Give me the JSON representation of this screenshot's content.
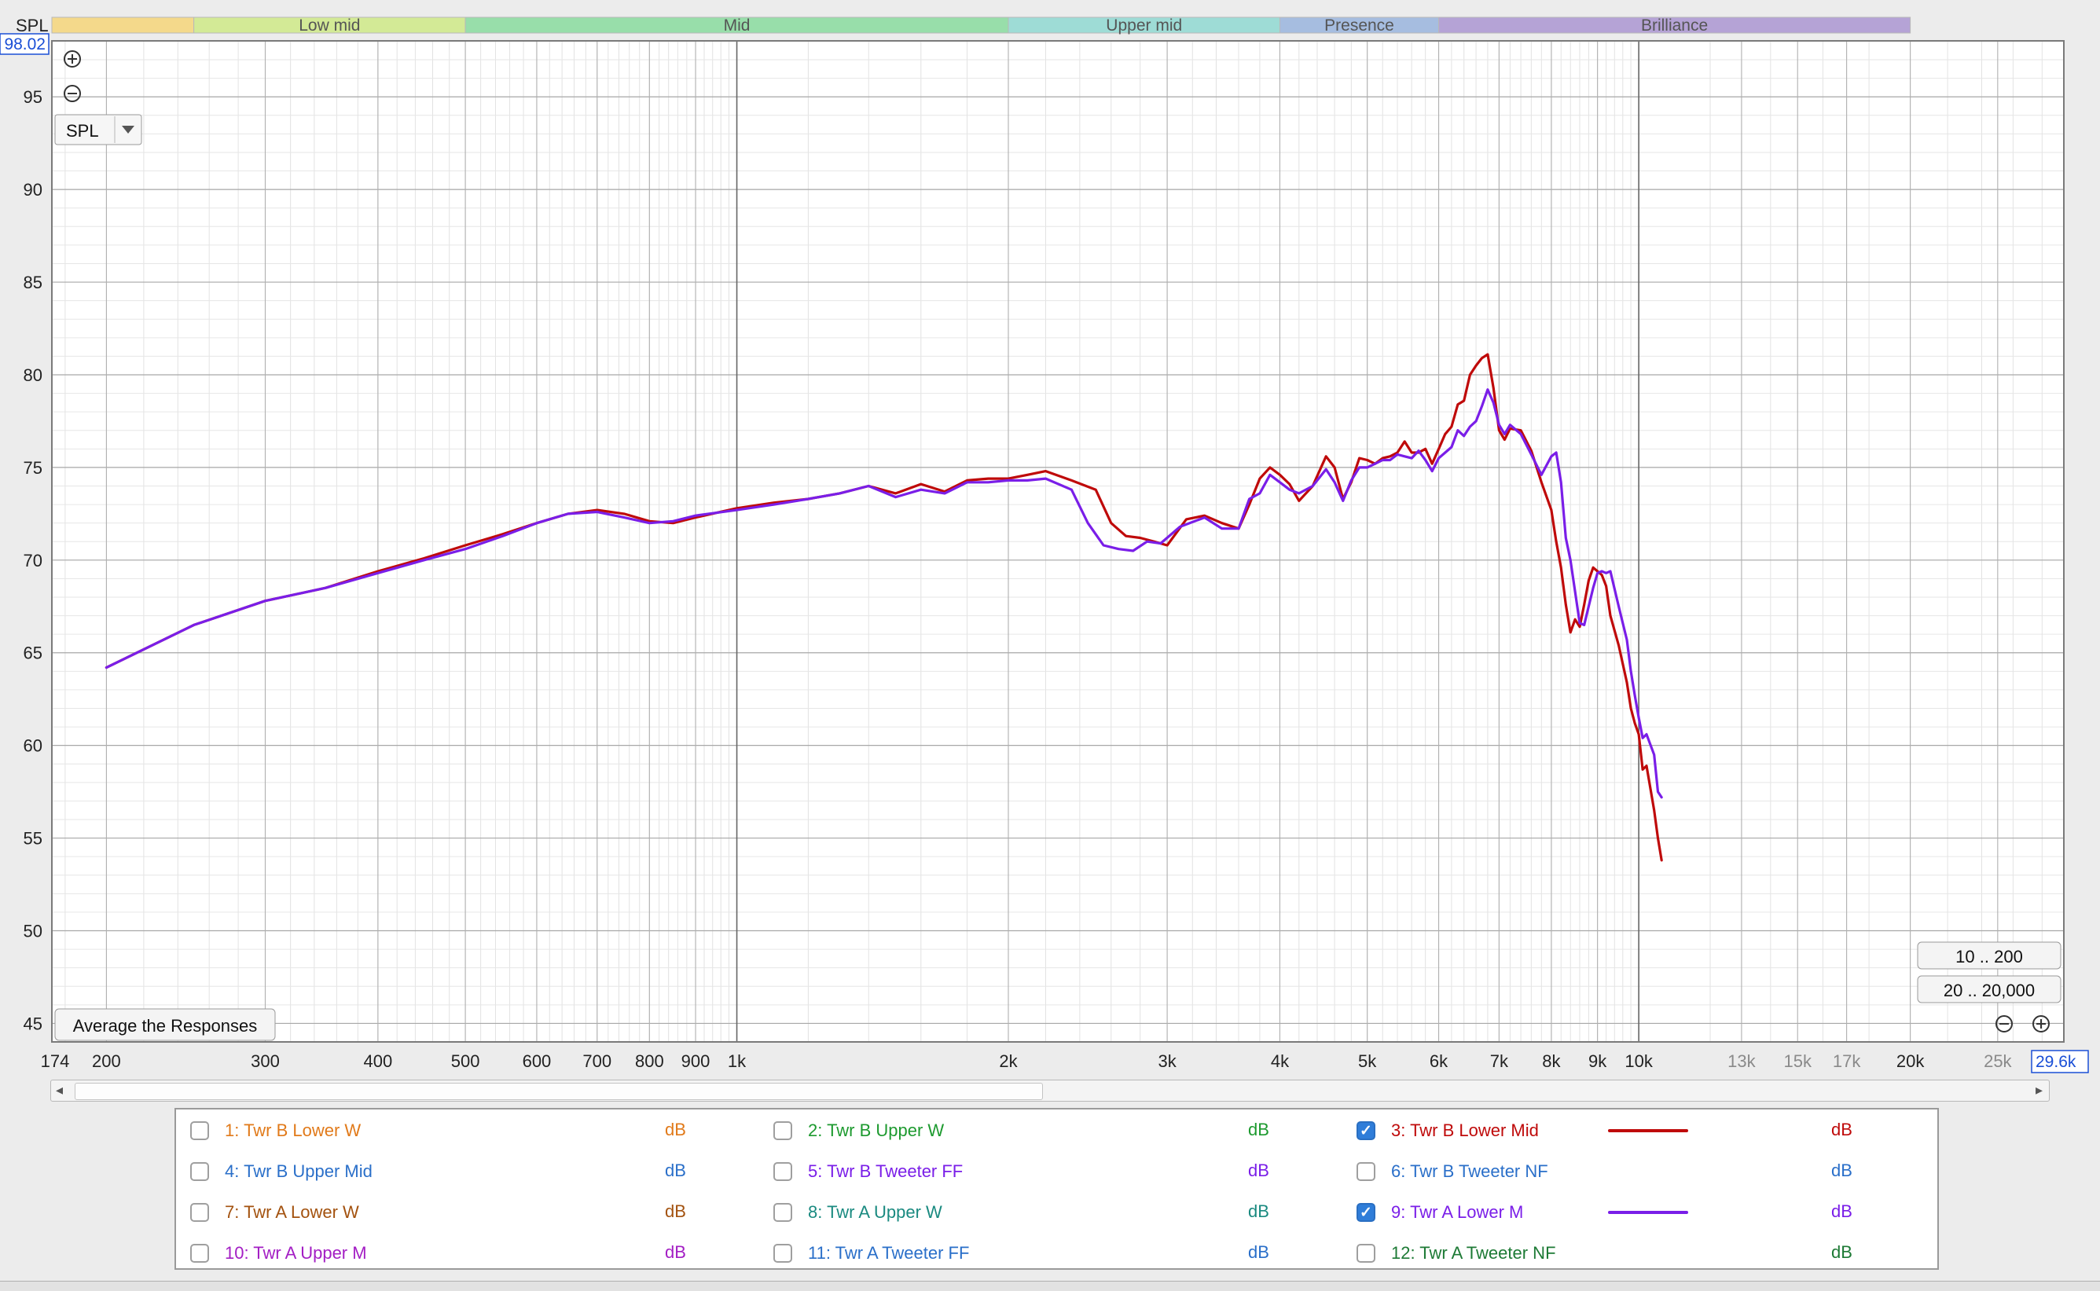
{
  "colors": {
    "curve_3": "#bf0a0a",
    "curve_9": "#7a1ee8",
    "grid_major": "#9a9a9a",
    "grid_minor": "#dddddd",
    "readout": "#1a4fd6"
  },
  "bands": [
    {
      "label": "",
      "from": 174,
      "to": 250,
      "color": "#f4d98b"
    },
    {
      "label": "Low mid",
      "from": 250,
      "to": 500,
      "color": "#d3ea96"
    },
    {
      "label": "Mid",
      "from": 500,
      "to": 2000,
      "color": "#98deaa"
    },
    {
      "label": "Upper mid",
      "from": 2000,
      "to": 4000,
      "color": "#9edcd6"
    },
    {
      "label": "Presence",
      "from": 4000,
      "to": 6000,
      "color": "#a6bde0"
    },
    {
      "label": "Brilliance",
      "from": 6000,
      "to": 20000,
      "color": "#b5a3d6"
    }
  ],
  "chart_data": {
    "type": "line",
    "ylabel": "SPL",
    "xlim": [
      174,
      29600
    ],
    "ylim": [
      44,
      98.02
    ],
    "x_scale": "log",
    "grid": true,
    "y_ticks": [
      95,
      90,
      85,
      80,
      75,
      70,
      65,
      60,
      55,
      50,
      45
    ],
    "x_ticks": [
      {
        "v": 200,
        "l": "200"
      },
      {
        "v": 300,
        "l": "300"
      },
      {
        "v": 400,
        "l": "400"
      },
      {
        "v": 500,
        "l": "500"
      },
      {
        "v": 600,
        "l": "600"
      },
      {
        "v": 700,
        "l": "700"
      },
      {
        "v": 800,
        "l": "800"
      },
      {
        "v": 900,
        "l": "900"
      },
      {
        "v": 1000,
        "l": "1k"
      },
      {
        "v": 2000,
        "l": "2k"
      },
      {
        "v": 3000,
        "l": "3k"
      },
      {
        "v": 4000,
        "l": "4k"
      },
      {
        "v": 5000,
        "l": "5k"
      },
      {
        "v": 6000,
        "l": "6k"
      },
      {
        "v": 7000,
        "l": "7k"
      },
      {
        "v": 8000,
        "l": "8k"
      },
      {
        "v": 9000,
        "l": "9k"
      },
      {
        "v": 10000,
        "l": "10k"
      },
      {
        "v": 13000,
        "l": "13k",
        "muted": true
      },
      {
        "v": 15000,
        "l": "15k",
        "muted": true
      },
      {
        "v": 17000,
        "l": "17k",
        "muted": true
      },
      {
        "v": 20000,
        "l": "20k"
      },
      {
        "v": 25000,
        "l": "25k",
        "muted": true
      }
    ],
    "x_min_label": "174",
    "x_max_label": "29.6k",
    "y_max_label": "98.02",
    "series": [
      {
        "name": "3: Twr B Lower Mid",
        "color": "#bf0a0a",
        "points": [
          [
            200,
            64.2
          ],
          [
            250,
            66.5
          ],
          [
            300,
            67.8
          ],
          [
            350,
            68.5
          ],
          [
            400,
            69.4
          ],
          [
            450,
            70.1
          ],
          [
            500,
            70.8
          ],
          [
            550,
            71.4
          ],
          [
            600,
            72.0
          ],
          [
            650,
            72.5
          ],
          [
            700,
            72.7
          ],
          [
            750,
            72.5
          ],
          [
            800,
            72.1
          ],
          [
            850,
            72.0
          ],
          [
            900,
            72.3
          ],
          [
            1000,
            72.8
          ],
          [
            1100,
            73.1
          ],
          [
            1200,
            73.3
          ],
          [
            1300,
            73.6
          ],
          [
            1400,
            74.0
          ],
          [
            1500,
            73.6
          ],
          [
            1600,
            74.1
          ],
          [
            1700,
            73.7
          ],
          [
            1800,
            74.3
          ],
          [
            1900,
            74.4
          ],
          [
            2000,
            74.4
          ],
          [
            2100,
            74.6
          ],
          [
            2200,
            74.8
          ],
          [
            2350,
            74.3
          ],
          [
            2500,
            73.8
          ],
          [
            2600,
            72.0
          ],
          [
            2700,
            71.3
          ],
          [
            2800,
            71.2
          ],
          [
            2900,
            71.0
          ],
          [
            3000,
            70.8
          ],
          [
            3150,
            72.2
          ],
          [
            3300,
            72.4
          ],
          [
            3450,
            72.0
          ],
          [
            3600,
            71.7
          ],
          [
            3700,
            73.0
          ],
          [
            3800,
            74.4
          ],
          [
            3900,
            75.0
          ],
          [
            4000,
            74.6
          ],
          [
            4100,
            74.1
          ],
          [
            4200,
            73.2
          ],
          [
            4350,
            74.0
          ],
          [
            4500,
            75.6
          ],
          [
            4600,
            75.0
          ],
          [
            4700,
            73.3
          ],
          [
            4800,
            74.2
          ],
          [
            4900,
            75.5
          ],
          [
            5000,
            75.4
          ],
          [
            5100,
            75.2
          ],
          [
            5200,
            75.5
          ],
          [
            5300,
            75.6
          ],
          [
            5400,
            75.8
          ],
          [
            5500,
            76.4
          ],
          [
            5600,
            75.8
          ],
          [
            5700,
            75.8
          ],
          [
            5800,
            76.0
          ],
          [
            5900,
            75.2
          ],
          [
            6000,
            76.0
          ],
          [
            6100,
            76.8
          ],
          [
            6200,
            77.2
          ],
          [
            6300,
            78.4
          ],
          [
            6400,
            78.6
          ],
          [
            6500,
            80.0
          ],
          [
            6600,
            80.5
          ],
          [
            6700,
            80.9
          ],
          [
            6800,
            81.1
          ],
          [
            6900,
            79.3
          ],
          [
            7000,
            77.0
          ],
          [
            7100,
            76.5
          ],
          [
            7200,
            77.1
          ],
          [
            7400,
            77.0
          ],
          [
            7600,
            75.9
          ],
          [
            7800,
            74.2
          ],
          [
            8000,
            72.7
          ],
          [
            8100,
            71.0
          ],
          [
            8200,
            69.6
          ],
          [
            8300,
            67.6
          ],
          [
            8400,
            66.1
          ],
          [
            8500,
            66.8
          ],
          [
            8600,
            66.4
          ],
          [
            8700,
            67.6
          ],
          [
            8800,
            68.9
          ],
          [
            8900,
            69.6
          ],
          [
            9000,
            69.4
          ],
          [
            9100,
            69.2
          ],
          [
            9200,
            68.6
          ],
          [
            9300,
            67.0
          ],
          [
            9500,
            65.4
          ],
          [
            9700,
            63.4
          ],
          [
            9800,
            62.0
          ],
          [
            9900,
            61.2
          ],
          [
            10000,
            60.6
          ],
          [
            10100,
            58.7
          ],
          [
            10200,
            58.9
          ],
          [
            10400,
            56.5
          ],
          [
            10500,
            55.0
          ],
          [
            10600,
            53.8
          ]
        ]
      },
      {
        "name": "9: Twr A Lower M",
        "color": "#7a1ee8",
        "points": [
          [
            200,
            64.2
          ],
          [
            250,
            66.5
          ],
          [
            300,
            67.8
          ],
          [
            350,
            68.5
          ],
          [
            400,
            69.3
          ],
          [
            450,
            70.0
          ],
          [
            500,
            70.6
          ],
          [
            550,
            71.3
          ],
          [
            600,
            72.0
          ],
          [
            650,
            72.5
          ],
          [
            700,
            72.6
          ],
          [
            750,
            72.3
          ],
          [
            800,
            72.0
          ],
          [
            850,
            72.1
          ],
          [
            900,
            72.4
          ],
          [
            1000,
            72.7
          ],
          [
            1100,
            73.0
          ],
          [
            1200,
            73.3
          ],
          [
            1300,
            73.6
          ],
          [
            1400,
            74.0
          ],
          [
            1500,
            73.4
          ],
          [
            1600,
            73.8
          ],
          [
            1700,
            73.6
          ],
          [
            1800,
            74.2
          ],
          [
            1900,
            74.2
          ],
          [
            2000,
            74.3
          ],
          [
            2100,
            74.3
          ],
          [
            2200,
            74.4
          ],
          [
            2350,
            73.8
          ],
          [
            2450,
            72.0
          ],
          [
            2550,
            70.8
          ],
          [
            2650,
            70.6
          ],
          [
            2750,
            70.5
          ],
          [
            2850,
            71.0
          ],
          [
            2950,
            70.9
          ],
          [
            3100,
            71.8
          ],
          [
            3300,
            72.3
          ],
          [
            3450,
            71.7
          ],
          [
            3600,
            71.7
          ],
          [
            3700,
            73.3
          ],
          [
            3800,
            73.6
          ],
          [
            3900,
            74.6
          ],
          [
            4000,
            74.2
          ],
          [
            4100,
            73.8
          ],
          [
            4200,
            73.6
          ],
          [
            4350,
            74.0
          ],
          [
            4500,
            74.9
          ],
          [
            4600,
            74.2
          ],
          [
            4700,
            73.2
          ],
          [
            4800,
            74.3
          ],
          [
            4900,
            75.0
          ],
          [
            5000,
            75.0
          ],
          [
            5100,
            75.2
          ],
          [
            5200,
            75.4
          ],
          [
            5300,
            75.4
          ],
          [
            5400,
            75.7
          ],
          [
            5500,
            75.6
          ],
          [
            5600,
            75.5
          ],
          [
            5700,
            75.9
          ],
          [
            5800,
            75.4
          ],
          [
            5900,
            74.8
          ],
          [
            6000,
            75.5
          ],
          [
            6100,
            75.8
          ],
          [
            6200,
            76.1
          ],
          [
            6300,
            77.0
          ],
          [
            6400,
            76.7
          ],
          [
            6500,
            77.2
          ],
          [
            6600,
            77.5
          ],
          [
            6700,
            78.3
          ],
          [
            6800,
            79.2
          ],
          [
            6900,
            78.5
          ],
          [
            7000,
            77.3
          ],
          [
            7100,
            76.8
          ],
          [
            7200,
            77.3
          ],
          [
            7400,
            76.8
          ],
          [
            7600,
            75.7
          ],
          [
            7800,
            74.6
          ],
          [
            8000,
            75.6
          ],
          [
            8100,
            75.8
          ],
          [
            8200,
            74.2
          ],
          [
            8300,
            71.2
          ],
          [
            8400,
            70.0
          ],
          [
            8500,
            68.3
          ],
          [
            8600,
            66.6
          ],
          [
            8700,
            66.5
          ],
          [
            8800,
            67.5
          ],
          [
            8900,
            68.5
          ],
          [
            9000,
            69.3
          ],
          [
            9100,
            69.4
          ],
          [
            9200,
            69.3
          ],
          [
            9300,
            69.4
          ],
          [
            9500,
            67.5
          ],
          [
            9700,
            65.7
          ],
          [
            9800,
            64.0
          ],
          [
            9900,
            62.7
          ],
          [
            10000,
            61.5
          ],
          [
            10100,
            60.4
          ],
          [
            10200,
            60.6
          ],
          [
            10400,
            59.5
          ],
          [
            10500,
            57.5
          ],
          [
            10600,
            57.2
          ]
        ]
      }
    ]
  },
  "ui": {
    "y_axis_title": "SPL",
    "zoom_in_icon": "zoom-in-icon",
    "zoom_out_icon": "zoom-out-icon",
    "spl_select": "SPL",
    "average_button": "Average the Responses",
    "range_btn_1": "10 .. 200",
    "range_btn_2": "20 .. 20,000"
  },
  "legend": [
    {
      "label": "1: Twr B Lower W",
      "color": "#e17a1a",
      "checked": false,
      "unit": "dB"
    },
    {
      "label": "2: Twr B Upper W",
      "color": "#1d9a2f",
      "checked": false,
      "unit": "dB"
    },
    {
      "label": "3: Twr B Lower Mid",
      "color": "#bf0a0a",
      "checked": true,
      "unit": "dB"
    },
    {
      "label": "4: Twr B Upper Mid",
      "color": "#2a6fc9",
      "checked": false,
      "unit": "dB"
    },
    {
      "label": "5: Twr B Tweeter FF",
      "color": "#7a1ee8",
      "checked": false,
      "unit": "dB"
    },
    {
      "label": "6: Twr B Tweeter NF",
      "color": "#2a6fc9",
      "checked": false,
      "unit": "dB"
    },
    {
      "label": "7: Twr A Lower W",
      "color": "#a3520f",
      "checked": false,
      "unit": "dB"
    },
    {
      "label": "8: Twr A Upper W",
      "color": "#1a8a80",
      "checked": false,
      "unit": "dB"
    },
    {
      "label": "9: Twr A Lower M",
      "color": "#7a1ee8",
      "checked": true,
      "unit": "dB"
    },
    {
      "label": "10: Twr A Upper M",
      "color": "#a31ec4",
      "checked": false,
      "unit": "dB"
    },
    {
      "label": "11: Twr A Tweeter FF",
      "color": "#2a6fc9",
      "checked": false,
      "unit": "dB"
    },
    {
      "label": "12: Twr A Tweeter NF",
      "color": "#1d7a35",
      "checked": false,
      "unit": "dB"
    }
  ]
}
